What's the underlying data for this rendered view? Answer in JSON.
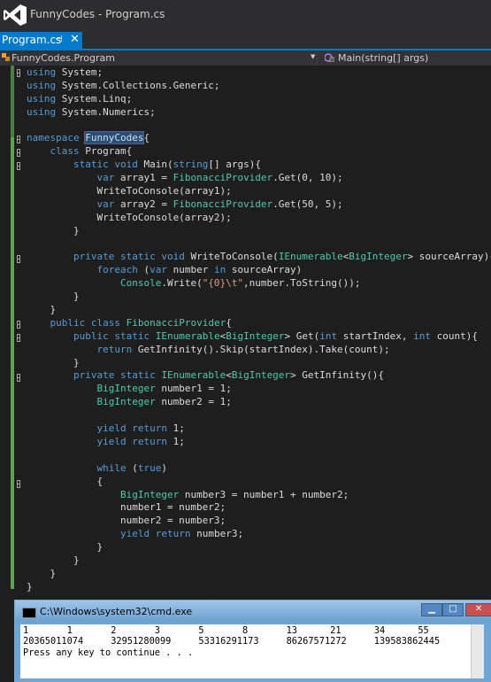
{
  "app": {
    "title": "FunnyCodes - Program.cs",
    "accent": "#007acc"
  },
  "tab": {
    "label": "Program.cs",
    "pin_glyph": "⊣",
    "close_glyph": "✕"
  },
  "navbar": {
    "left_label": "FunnyCodes.Program",
    "right_label": "Main(string[] args)"
  },
  "code_lines": [
    "using System;",
    "using System.Collections.Generic;",
    "using System.Linq;",
    "using System.Numerics;",
    "",
    "namespace FunnyCodes{",
    "    class Program{",
    "        static void Main(string[] args){",
    "            var array1 = FibonacciProvider.Get(0, 10);",
    "            WriteToConsole(array1);",
    "            var array2 = FibonacciProvider.Get(50, 5);",
    "            WriteToConsole(array2);",
    "        }",
    "",
    "        private static void WriteToConsole(IEnumerable<BigInteger> sourceArray){",
    "            foreach (var number in sourceArray)",
    "                Console.Write(\"{0}\\t\",number.ToString());",
    "        }",
    "    }",
    "    public class FibonacciProvider{",
    "        public static IEnumerable<BigInteger> Get(int startIndex, int count){",
    "            return GetInfinity().Skip(startIndex).Take(count);",
    "        }",
    "        private static IEnumerable<BigInteger> GetInfinity(){",
    "            BigInteger number1 = 1;",
    "            BigInteger number2 = 1;",
    "",
    "            yield return 1;",
    "            yield return 1;",
    "",
    "            while (true)",
    "            {",
    "                BigInteger number3 = number1 + number2;",
    "                number1 = number2;",
    "                number2 = number3;",
    "                yield return number3;",
    "            }",
    "        }",
    "    }",
    "}"
  ],
  "console": {
    "title": "C:\\Windows\\system32\\cmd.exe",
    "min_glyph": "▁",
    "max_glyph": "□",
    "close_glyph": "✕",
    "output": "1       1       2       3       5       8       13      21      34      55\n20365011074     32951280099     53316291173     86267571272     139583862445\nPress any key to continue . . ."
  },
  "colors": {
    "keyword": "#569cd6",
    "type": "#4ec9b0",
    "string": "#d69d85",
    "text": "#dcdcdc",
    "background": "#1e1e1e"
  }
}
